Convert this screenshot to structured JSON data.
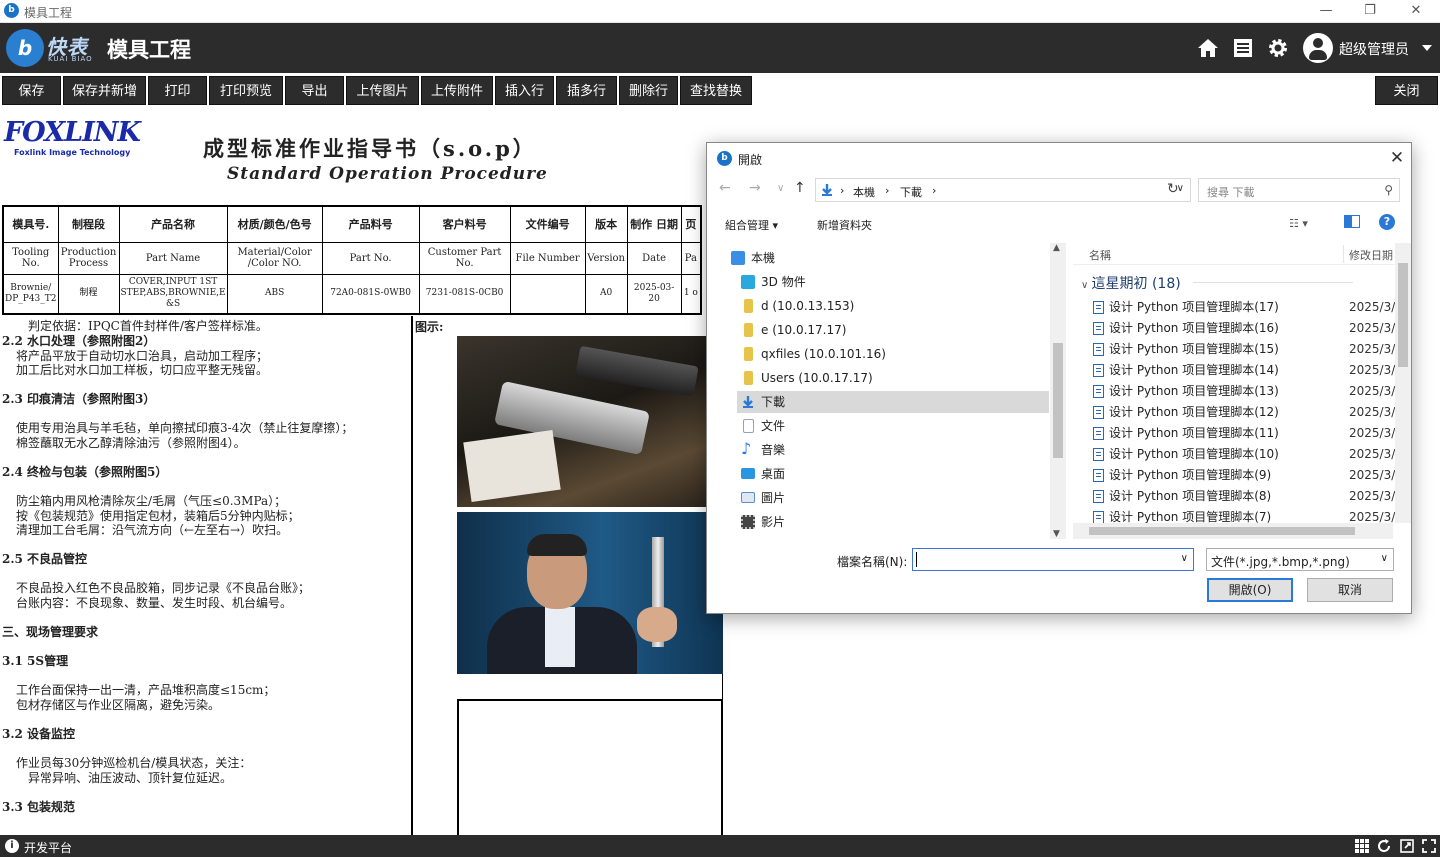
{
  "window": {
    "title": "模具工程",
    "logo": "b"
  },
  "header": {
    "brand_cn": "快表",
    "brand_en": "KUAI BIAO",
    "brand_mark": "b",
    "title": "模具工程",
    "user_name": "超级管理员"
  },
  "toolbar": {
    "buttons": [
      "保存",
      "保存并新增",
      "打印",
      "打印预览",
      "导出",
      "上传图片",
      "上传附件",
      "插入行",
      "插多行",
      "删除行",
      "查找替换"
    ],
    "close": "关闭"
  },
  "document": {
    "logo": "FOXLINK",
    "logo_sub": "Foxlink Image Technology",
    "title_cn": "成型标准作业指导书（s.o.p）",
    "title_en": "Standard  Operation  Procedure",
    "table": {
      "headers_cn": [
        "模具号.",
        "制程段",
        "产品名称",
        "材质/颜色/色号",
        "产品料号",
        "客户料号",
        "文件编号",
        "版本",
        "制作 日期",
        "页"
      ],
      "headers_en": [
        "Tooling No.",
        "Production Process",
        "Part Name",
        "Material/Color /Color NO.",
        "Part No.",
        "Customer Part No.",
        "File Number",
        "Version",
        "Date",
        "Pa"
      ],
      "row": [
        "Brownie/ DP_P43_T2",
        "制程",
        "COVER,INPUT 1ST STEP,ABS,BROWNIE,E &S",
        "ABS",
        "72A0-081S-0WB0",
        "7231-081S-0CB0",
        "",
        "A0",
        "2025-03-20",
        "1 o"
      ]
    },
    "body_lines": [
      {
        "text": "判定依据：IPQC首件封样件/客户签样标准。",
        "bold": false
      },
      {
        "text": "2.2 水口处理（参照附图2）",
        "bold": true
      },
      {
        "text": "将产品平放于自动切水口治具，启动加工程序；",
        "bold": false
      },
      {
        "text": "加工后比对水口加工样板，切口应平整无残留。",
        "bold": false
      },
      {
        "text": "2.3 印痕清洁（参照附图3）",
        "bold": true
      },
      {
        "text": "使用专用治具与羊毛毡，单向擦拭印痕3-4次（禁止往复摩擦）；",
        "bold": false
      },
      {
        "text": "棉签蘸取无水乙醇清除油污（参照附图4）。",
        "bold": false
      },
      {
        "text": "2.4 终检与包装（参照附图5）",
        "bold": true
      },
      {
        "text": "防尘箱内用风枪清除灰尘/毛屑（气压≤0.3MPa）；",
        "bold": false
      },
      {
        "text": "按《包装规范》使用指定包材，装箱后5分钟内贴标；",
        "bold": false
      },
      {
        "text": "清理加工台毛屑：沿气流方向（←左至右→）吹扫。",
        "bold": false
      },
      {
        "text": "2.5 不良品管控",
        "bold": true
      },
      {
        "text": "不良品投入红色不良品胶箱，同步记录《不良品台账》；",
        "bold": false
      },
      {
        "text": "台账内容：不良现象、数量、发生时段、机台编号。",
        "bold": false
      },
      {
        "text": "三、现场管理要求",
        "bold": true
      },
      {
        "text": "3.1 5S管理",
        "bold": true
      },
      {
        "text": "工作台面保持一出一清，产品堆积高度≤15cm；",
        "bold": false
      },
      {
        "text": "包材存储区与作业区隔离，避免污染。",
        "bold": false
      },
      {
        "text": "3.2 设备监控",
        "bold": true
      },
      {
        "text": "作业员每30分钟巡检机台/模具状态，关注：",
        "bold": false
      },
      {
        "text": "异常异响、油压波动、顶针复位延迟。",
        "bold": false
      },
      {
        "text": "3.3 包装规范",
        "bold": true
      }
    ],
    "figure_label": "图示:"
  },
  "dialog": {
    "title": "開啟",
    "logo": "b",
    "path": [
      "本機",
      "下載"
    ],
    "search_placeholder": "搜尋 下載",
    "organize": "組合管理",
    "new_folder": "新增資料夾",
    "nav_items": [
      {
        "label": "本機",
        "icon": "computer-icon",
        "color": "#3a8ee6"
      },
      {
        "label": "3D 物件",
        "icon": "3d-objects-icon",
        "color": "#29a9e0"
      },
      {
        "label": "d (10.0.13.153)",
        "icon": "network-drive-icon",
        "color": "#e6c34a"
      },
      {
        "label": "e (10.0.17.17)",
        "icon": "network-drive-icon",
        "color": "#e6c34a"
      },
      {
        "label": "qxfiles (10.0.101.16)",
        "icon": "network-drive-icon",
        "color": "#e6c34a"
      },
      {
        "label": "Users (10.0.17.17)",
        "icon": "network-drive-icon",
        "color": "#e6c34a"
      },
      {
        "label": "下載",
        "icon": "downloads-icon",
        "color": "#2a79d7"
      },
      {
        "label": "文件",
        "icon": "documents-icon",
        "color": "#8aa4c8"
      },
      {
        "label": "音樂",
        "icon": "music-icon",
        "color": "#2a79d7"
      },
      {
        "label": "桌面",
        "icon": "desktop-icon",
        "color": "#2a95e0"
      },
      {
        "label": "圖片",
        "icon": "pictures-icon",
        "color": "#5a8fc8"
      },
      {
        "label": "影片",
        "icon": "videos-icon",
        "color": "#444"
      }
    ],
    "selected_nav": "下載",
    "col_name": "名稱",
    "col_date": "修改日期",
    "group_label": "這星期初 (18)",
    "files": [
      {
        "name": "设计 Python 项目管理脚本(17)",
        "date": "2025/3/"
      },
      {
        "name": "设计 Python 项目管理脚本(16)",
        "date": "2025/3/"
      },
      {
        "name": "设计 Python 项目管理脚本(15)",
        "date": "2025/3/"
      },
      {
        "name": "设计 Python 项目管理脚本(14)",
        "date": "2025/3/"
      },
      {
        "name": "设计 Python 项目管理脚本(13)",
        "date": "2025/3/"
      },
      {
        "name": "设计 Python 项目管理脚本(12)",
        "date": "2025/3/"
      },
      {
        "name": "设计 Python 项目管理脚本(11)",
        "date": "2025/3/"
      },
      {
        "name": "设计 Python 项目管理脚本(10)",
        "date": "2025/3/"
      },
      {
        "name": "设计 Python 项目管理脚本(9)",
        "date": "2025/3/"
      },
      {
        "name": "设计 Python 项目管理脚本(8)",
        "date": "2025/3/"
      },
      {
        "name": "设计 Python 项目管理脚本(7)",
        "date": "2025/3/"
      }
    ],
    "filename_label": "檔案名稱(N):",
    "filename_value": "",
    "filetype": "文件(*.jpg,*.bmp,*.png)",
    "open_button": "開啟(O)",
    "cancel_button": "取消"
  },
  "statusbar": {
    "text": "开发平台"
  }
}
